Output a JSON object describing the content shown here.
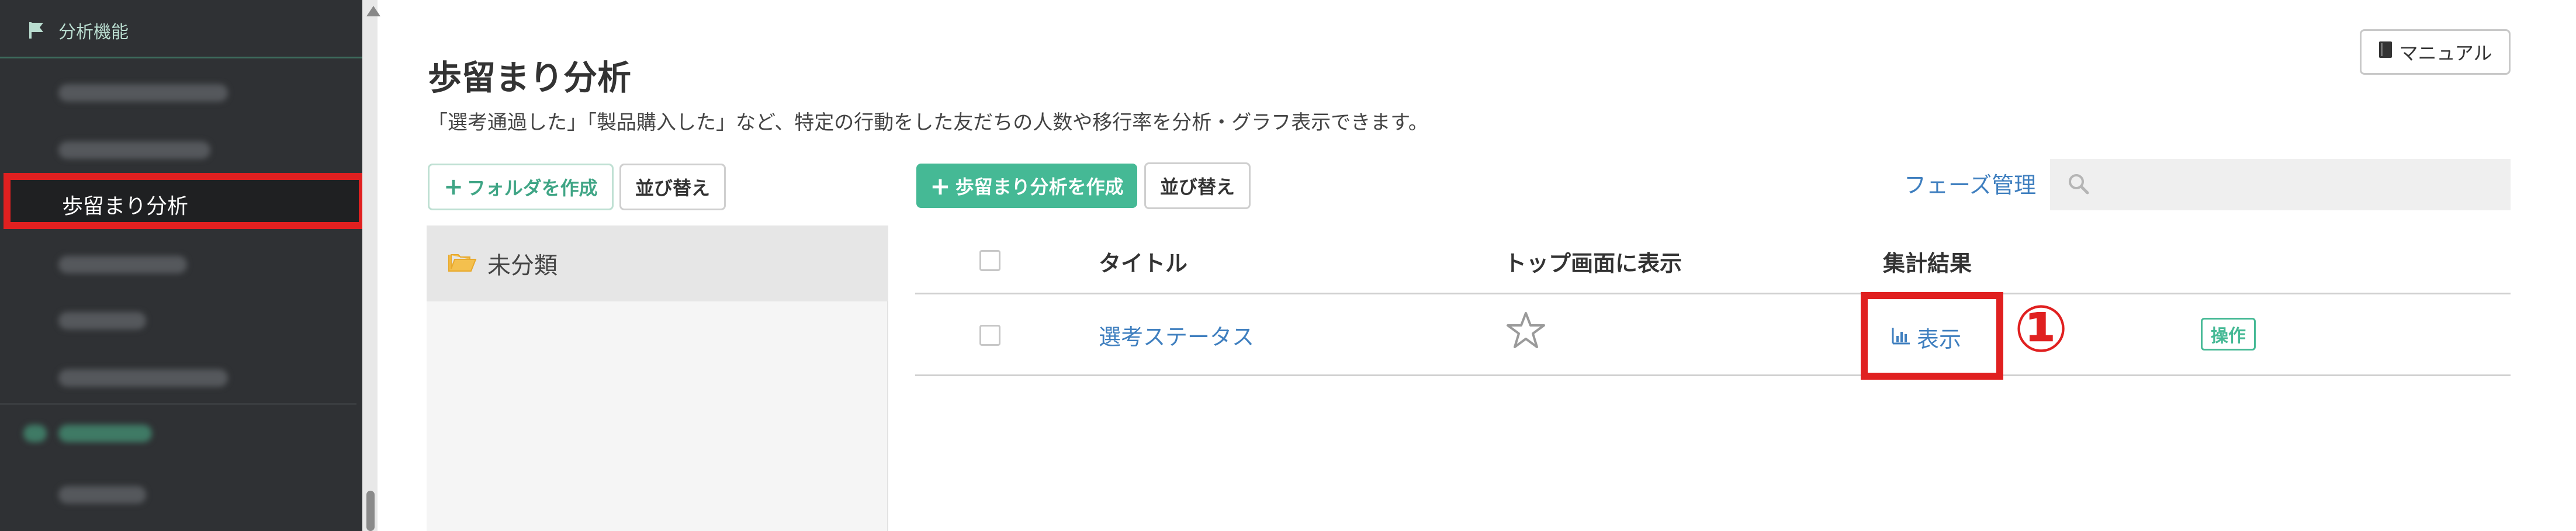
{
  "sidebar": {
    "section_title": "分析機能",
    "active_item": "歩留まり分析",
    "colors": {
      "background": "#2f3134",
      "active_border": "#e02020"
    }
  },
  "main": {
    "title": "歩留まり分析",
    "description": "「選考通過した」「製品購入した」など、特定の行動をした友だちの人数や移行率を分析・グラフ表示できます。",
    "manual_button": "マニュアル",
    "folder_toolbar": {
      "create_folder": "フォルダを作成",
      "sort": "並び替え"
    },
    "list_toolbar": {
      "create_analysis": "歩留まり分析を作成",
      "sort": "並び替え"
    },
    "phase_link": "フェーズ管理",
    "search": {
      "placeholder": ""
    },
    "folders": [
      {
        "label": "未分類"
      }
    ],
    "table": {
      "headers": {
        "title": "タイトル",
        "show_top": "トップ画面に表示",
        "result": "集計結果"
      },
      "rows": [
        {
          "title": "選考ステータス",
          "result_label": "表示",
          "action": "操作"
        }
      ]
    },
    "annotation_number": "①",
    "colors": {
      "accent_green": "#45b995",
      "link_blue": "#3f7fbf",
      "highlight_red": "#e02020"
    }
  }
}
